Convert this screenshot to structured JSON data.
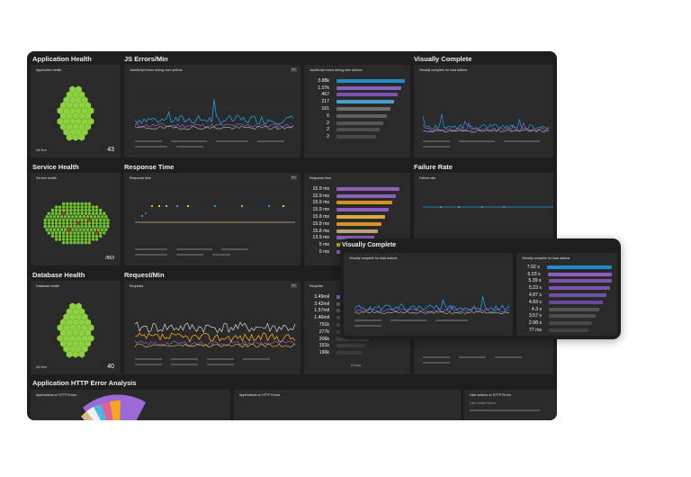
{
  "sections": {
    "app_health": "Application Health",
    "js_errors": "JS Errors/Min",
    "visually_complete": "Visually Complete",
    "service_health": "Service Health",
    "response_time": "Response Time",
    "failure_rate": "Failure Rate",
    "database_health": "Database Health",
    "requests": "Request/Min",
    "http_error": "Application HTTP Error Analysis"
  },
  "tiles": {
    "app_health": {
      "title": "Application health",
      "status": "All fine",
      "count": "43"
    },
    "js_chart": {
      "title": "JavaScript errors during user actions",
      "btn": "5m"
    },
    "js_list": {
      "title": "JavaScript errors during user actions",
      "values": [
        "3.88k",
        "1.07k",
        "467",
        "217",
        "161",
        "6",
        "2",
        "2",
        "2"
      ]
    },
    "vc_chart": {
      "title": "Visually complete for load actions"
    },
    "service_health": {
      "title": "Service health",
      "count": "/563"
    },
    "rt_chart": {
      "title": "Response time",
      "btn": "5m"
    },
    "rt_list": {
      "title": "Response time",
      "values": [
        "15.9 ms",
        "15.9 ms",
        "15.9 ms",
        "15.9 ms",
        "15.8 ms",
        "15.8 ms",
        "15.8 ms",
        "13.9 ms",
        "5 ms",
        "5 ms"
      ]
    },
    "failure": {
      "title": "Failure rate"
    },
    "db_health": {
      "title": "Database health",
      "status": "All fine",
      "count": "40"
    },
    "req_chart": {
      "title": "Requests",
      "btn": "5m"
    },
    "req_list": {
      "title": "Requests",
      "values": [
        "3.49mil",
        "3.42mil",
        "1.57mil",
        "1.46mil",
        "791k",
        "277k",
        "206k",
        "191k",
        "190k"
      ],
      "more": "5 more"
    },
    "http1": {
      "title": "Applications w/ HTTP Errors"
    },
    "http2": {
      "title": "Applications w/ HTTP Errors"
    },
    "http3": {
      "title": "User Actions w/ HTTP Errors",
      "sub": "User Action Name"
    }
  },
  "popup": {
    "section": "Visually Complete",
    "chart_title": "Visually complete for load actions",
    "list_title": "Visually complete for load actions",
    "values": [
      "7.02 s",
      "6.03 s",
      "5.39 s",
      "5.23 s",
      "4.87 s",
      "4.83 s",
      "4.3 s",
      "3.57 s",
      "2.98 s",
      "77 ms"
    ]
  },
  "colors": {
    "hex": "#8cd13f",
    "accent": "#1f9ee8",
    "purple": "#9b6ad6",
    "orange": "#f5a623"
  }
}
